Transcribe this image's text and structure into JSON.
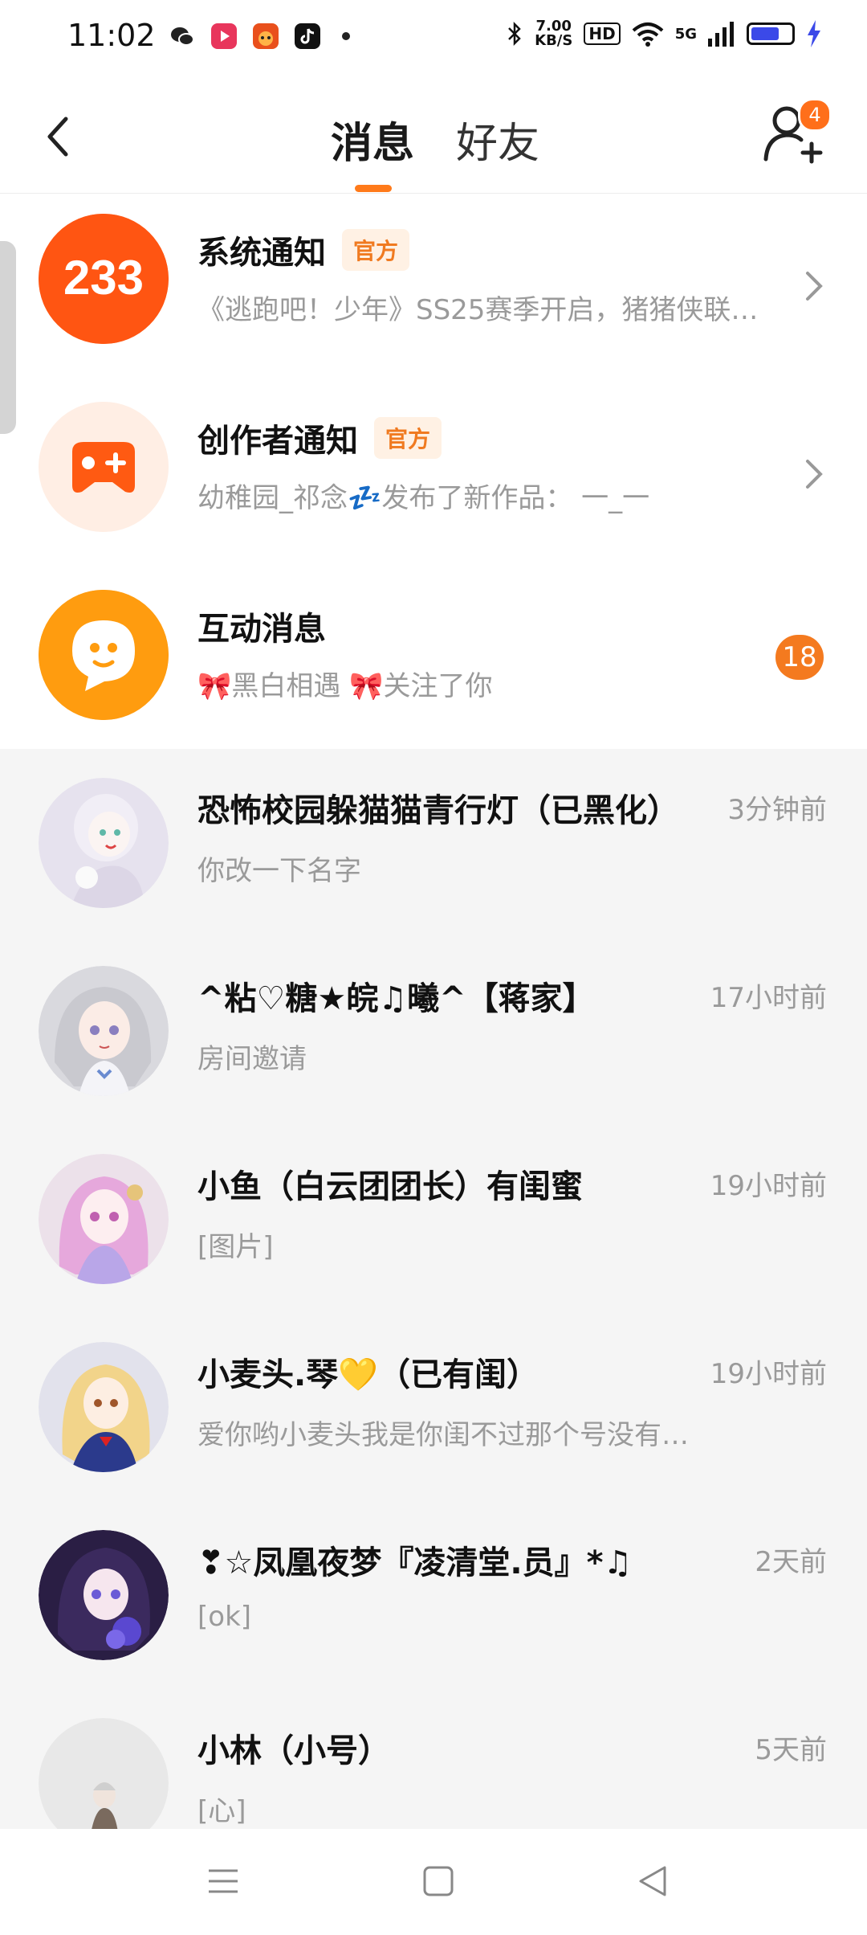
{
  "status_bar": {
    "time": "11:02",
    "speed_top": "7.00",
    "speed_bottom": "KB/S",
    "hd": "HD",
    "network": "5G",
    "battery_level": 0.7
  },
  "header": {
    "tabs": [
      {
        "label": "消息",
        "active": true
      },
      {
        "label": "好友",
        "active": false
      }
    ],
    "friend_request_badge": "4",
    "accent_color": "#ff7a1a"
  },
  "notifications": [
    {
      "title": "系统通知",
      "tag": "官方",
      "subtitle": "《逃跑吧！少年》SS25赛季开启，猪猪侠联…",
      "icon": "233-logo-icon"
    },
    {
      "title": "创作者通知",
      "tag": "官方",
      "subtitle": "幼稚园_祁念💤发布了新作品：  一_一",
      "icon": "gamepad-plus-icon"
    },
    {
      "title": "互动消息",
      "subtitle": "🎀黑白相遇 🎀关注了你",
      "badge": "18",
      "icon": "chat-bubble-icon"
    }
  ],
  "logo_text": "233",
  "chats": [
    {
      "name": "恐怖校园躲猫猫青行灯（已黑化）",
      "message": "你改一下名字",
      "time": "3分钟前"
    },
    {
      "name": "^粘♡糖★皖♫曦^【蒋家】",
      "message": "房间邀请",
      "time": "17小时前"
    },
    {
      "name": "小鱼（白云团团长）有闺蜜",
      "message": "[图片]",
      "time": "19小时前"
    },
    {
      "name": "小麦头.琴💛（已有闺）",
      "message": "爱你哟小麦头我是你闺不过那个号没有…",
      "time": "19小时前"
    },
    {
      "name": "❣☆凤凰夜梦『凌清堂.员』*♫",
      "message": "[ok]",
      "time": "2天前"
    },
    {
      "name": "小林（小号）",
      "message": "[心]",
      "time": "5天前"
    }
  ]
}
